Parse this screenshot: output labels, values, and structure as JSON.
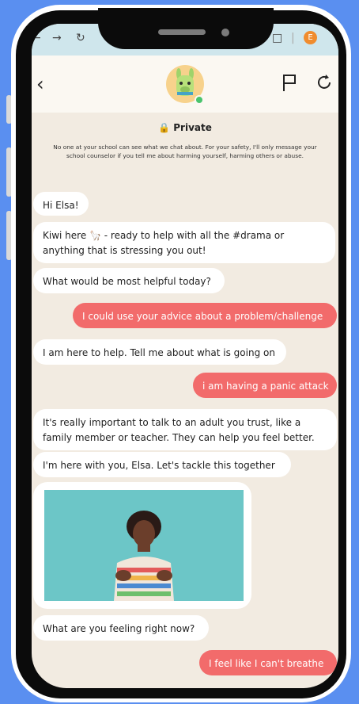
{
  "browser": {
    "back_icon": "arrow-back-icon",
    "forward_icon": "arrow-forward-icon",
    "reload_icon": "reload-icon",
    "extensions_icon": "puzzle-icon",
    "profile_initial": "E"
  },
  "header": {
    "back_icon": "chevron-left-icon",
    "avatar": "llama-avatar",
    "flag_icon": "flag-icon",
    "refresh_icon": "refresh-icon"
  },
  "privacy": {
    "title": "Private",
    "notice": "No one at your school can see what we chat about. For your safety, I'll only message your school counselor if you tell me about harming yourself, harming others or abuse."
  },
  "messages": [
    {
      "from": "bot",
      "text": "Hi Elsa!"
    },
    {
      "from": "bot",
      "text": "Kiwi here 🦙 - ready to help with all the #drama or anything that is stressing you out!"
    },
    {
      "from": "bot",
      "text": "What would be most helpful today?"
    },
    {
      "from": "user",
      "text": "I could use your advice about a problem/challenge"
    },
    {
      "from": "bot",
      "text": "I am here to help. Tell me about what is going on"
    },
    {
      "from": "user",
      "text": "i am having a panic attack"
    },
    {
      "from": "bot",
      "text": "It's really important to talk to an adult you trust, like a family member or teacher. They can help you feel better."
    },
    {
      "from": "bot",
      "text": "I'm here with you, Elsa. Let's tackle this together"
    },
    {
      "from": "bot",
      "type": "video"
    },
    {
      "from": "bot",
      "text": "What are you feeling right now?"
    },
    {
      "from": "user",
      "text": "I feel like I can't breathe"
    }
  ],
  "colors": {
    "background": "#5a8ff0",
    "user_bubble": "#f26b6b",
    "bot_bubble": "#ffffff",
    "chat_bg": "#f2ebe1"
  }
}
